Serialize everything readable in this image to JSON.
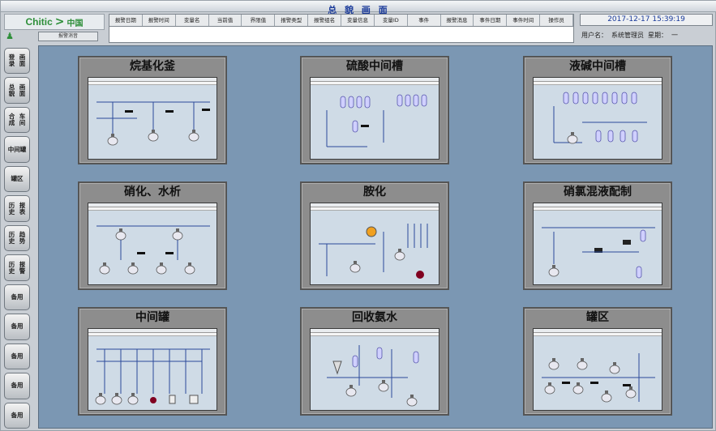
{
  "window": {
    "title": "总 貌 画 面"
  },
  "logo": {
    "brand": "Chitic",
    "chinese": "中国"
  },
  "alarm": {
    "button": "报警消音",
    "columns": [
      "报警日期",
      "报警时间",
      "变量名",
      "当前值",
      "界限值",
      "报警类型",
      "报警组名",
      "变量信息",
      "变量ID",
      "事件",
      "报警消息",
      "事件日期",
      "事件时间",
      "操作员"
    ]
  },
  "status": {
    "datetime": "2017-12-17 15:39:19",
    "user_label": "用户名：",
    "user_name": "系统管理员",
    "week_label": "星期：",
    "week_value": "一"
  },
  "sidebar": {
    "items": [
      {
        "line1": "登录",
        "line2": "画面"
      },
      {
        "line1": "总貌",
        "line2": "画面"
      },
      {
        "line1": "合成",
        "line2": "车间"
      },
      {
        "line1": "中间",
        "line2": "罐"
      },
      {
        "line1": "罐区",
        "line2": ""
      },
      {
        "line1": "历史",
        "line2": "报表"
      },
      {
        "line1": "历史",
        "line2": "趋势"
      },
      {
        "line1": "历史",
        "line2": "报警"
      },
      {
        "line1": "备",
        "line2": "用"
      },
      {
        "line1": "备",
        "line2": "用"
      },
      {
        "line1": "备",
        "line2": "用"
      },
      {
        "line1": "备",
        "line2": "用"
      },
      {
        "line1": "备",
        "line2": "用"
      }
    ]
  },
  "panels": [
    {
      "title": "烷基化釜"
    },
    {
      "title": "硫酸中间槽"
    },
    {
      "title": "液碱中间槽"
    },
    {
      "title": "硝化、水析"
    },
    {
      "title": "胺化"
    },
    {
      "title": "硝氯混液配制"
    },
    {
      "title": "中间罐"
    },
    {
      "title": "回收氨水"
    },
    {
      "title": "罐区"
    }
  ]
}
